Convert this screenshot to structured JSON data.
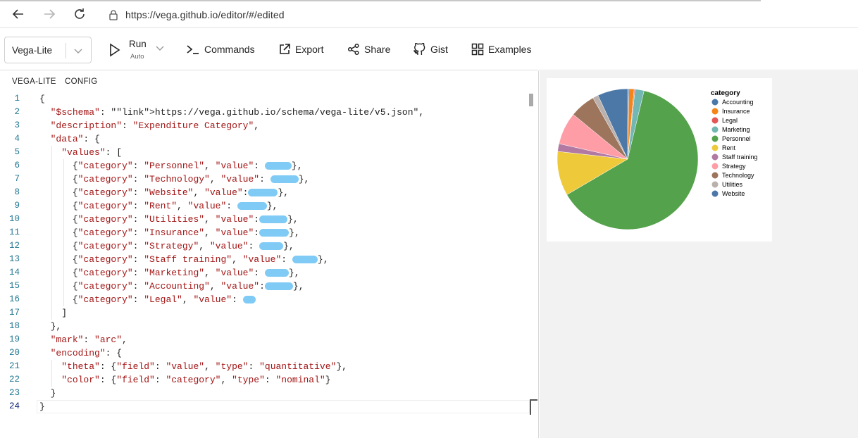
{
  "browser": {
    "url": "https://vega.github.io/editor/#/edited"
  },
  "toolbar": {
    "mode": "Vega-Lite",
    "run_label": "Run",
    "run_sub": "Auto",
    "commands_label": "Commands",
    "export_label": "Export",
    "share_label": "Share",
    "gist_label": "Gist",
    "examples_label": "Examples"
  },
  "editor": {
    "tabs": [
      "VEGA-LITE",
      "CONFIG"
    ],
    "line_numbers": [
      "1",
      "2",
      "3",
      "4",
      "5",
      "6",
      "7",
      "8",
      "9",
      "10",
      "11",
      "12",
      "13",
      "14",
      "15",
      "16",
      "17",
      "18",
      "19",
      "20",
      "21",
      "22",
      "23",
      "24"
    ],
    "lines": [
      "{",
      "  \"$schema\": \"https://vega.github.io/schema/vega-lite/v5.json\",",
      "  \"description\": \"Expenditure Category\",",
      "  \"data\": {",
      "    \"values\": [",
      "      {\"category\": \"Personnel\", \"value\": ",
      "      {\"category\": \"Technology\", \"value\": ",
      "      {\"category\": \"Website\", \"value\":",
      "      {\"category\": \"Rent\", \"value\": ",
      "      {\"category\": \"Utilities\", \"value\":",
      "      {\"category\": \"Insurance\", \"value\":",
      "      {\"category\": \"Strategy\", \"value\": ",
      "      {\"category\": \"Staff training\", \"value\": ",
      "      {\"category\": \"Marketing\", \"value\": ",
      "      {\"category\": \"Accounting\", \"value\":",
      "      {\"category\": \"Legal\", \"value\": ",
      "    ]",
      "  },",
      "  \"mark\": \"arc\",",
      "  \"encoding\": {",
      "    \"theta\": {\"field\": \"value\", \"type\": \"quantitative\"},",
      "    \"color\": {\"field\": \"category\", \"type\": \"nominal\"}",
      "  }",
      "}"
    ],
    "line_suffixes": {
      "6": "},",
      "7": "},",
      "8": "},",
      "9": "},",
      "10": "},",
      "11": "},",
      "12": "},",
      "13": "},",
      "14": "},",
      "15": "},",
      "16": ""
    }
  },
  "colors": {
    "Accounting": "#4c78a8",
    "Insurance": "#f58518",
    "Legal": "#e45756",
    "Marketing": "#72b7b2",
    "Personnel": "#54a24b",
    "Rent": "#eeca3b",
    "Staff training": "#b279a2",
    "Strategy": "#ff9da6",
    "Technology": "#9d755d",
    "Utilities": "#bab0ac",
    "Website": "#4c78a8"
  },
  "chart_data": {
    "type": "pie",
    "legend_title": "category",
    "legend_position": "right",
    "categories": [
      "Accounting",
      "Insurance",
      "Legal",
      "Marketing",
      "Personnel",
      "Rent",
      "Staff training",
      "Strategy",
      "Technology",
      "Utilities",
      "Website"
    ],
    "values": [
      0.3,
      1.2,
      0.2,
      2.1,
      63.5,
      10.3,
      1.8,
      7.5,
      5.9,
      1.3,
      7.0
    ]
  }
}
